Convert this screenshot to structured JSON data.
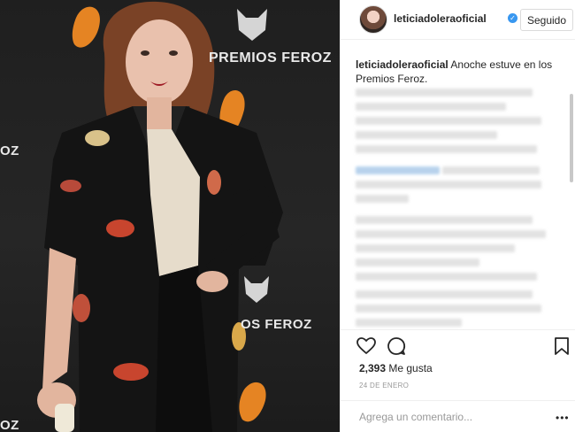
{
  "photo": {
    "backdrop_texts": [
      "PREMIOS FEROZ",
      "OS FEROZ",
      "OZ",
      "OZ"
    ]
  },
  "post": {
    "username": "leticiadoleraoficial",
    "verified_icon": "verified-badge-icon",
    "follow_label": "Seguido",
    "caption": {
      "username": "leticiadoleraoficial",
      "text": "Anoche estuve en los Premios Feroz."
    },
    "likes_count": "2,393",
    "likes_label": "Me gusta",
    "date": "24 DE ENERO",
    "comment_placeholder": "Agrega un comentario...",
    "more_label": "•••"
  },
  "icons": {
    "like": "heart-icon",
    "comment": "comment-bubble-icon",
    "save": "bookmark-icon",
    "more": "more-options-icon"
  },
  "colors": {
    "verified": "#3897f0",
    "border": "#efefef",
    "muted_text": "#999999",
    "text": "#262626"
  }
}
